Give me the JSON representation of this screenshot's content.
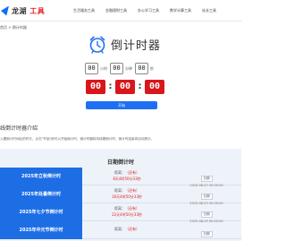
{
  "header": {
    "logo_text": "龙湖",
    "logo_accent": "工具",
    "nav": [
      "生活服务工具",
      "金融理财工具",
      "办公学习工具",
      "数学计算工具",
      "站长工具"
    ]
  },
  "breadcrumb": "首页 > 倒计时器",
  "title": "倒计时器",
  "inputs": {
    "hours": "00",
    "hours_unit": "小时",
    "minutes": "00",
    "minutes_unit": "分钟",
    "seconds": "00",
    "seconds_unit": "秒"
  },
  "display": {
    "hours": "00",
    "minutes": "00",
    "seconds": "00",
    "sep": ":"
  },
  "start_label": "开始",
  "section": {
    "title": "线倒计时器介绍",
    "desc": "入要倒计时间后的时长，点击\"开始\"即可以开始倒计时，倒计时器将持续着倒计时，倒计时结束将自动提示。"
  },
  "panel_title": "日期倒计时",
  "events": [
    {
      "name": "2025年立秋倒计时",
      "status_prefix": "距离：",
      "status_tag": "（还有）",
      "remaining": "8天4时50分33秒",
      "date_label": "日期",
      "date": "2025-08-07 00:00:00"
    },
    {
      "name": "2025年处暑倒计时",
      "status_prefix": "距离：",
      "status_tag": "（还有）",
      "remaining": "16天4时50分33秒",
      "date_label": "日期",
      "date": "2025-08-23 00:00:00"
    },
    {
      "name": "2025年七夕节倒计时",
      "status_prefix": "距离：",
      "status_tag": "（还有）",
      "remaining": "22天4时50分33秒",
      "date_label": "日期",
      "date": "2025-08-29 00:00:00"
    },
    {
      "name": "2025年中元节倒计时",
      "status_prefix": "距离：",
      "status_tag": "（还有）",
      "remaining": "",
      "date_label": "日期",
      "date": ""
    }
  ],
  "colors": {
    "accent": "#1e6ff2",
    "digit_bg": "#d9171b",
    "event_bg": "#1d6ee5",
    "panel_bg": "#eef3fa"
  },
  "icons": {
    "logo": "logo-mark-icon",
    "clock": "alarm-clock-icon"
  }
}
